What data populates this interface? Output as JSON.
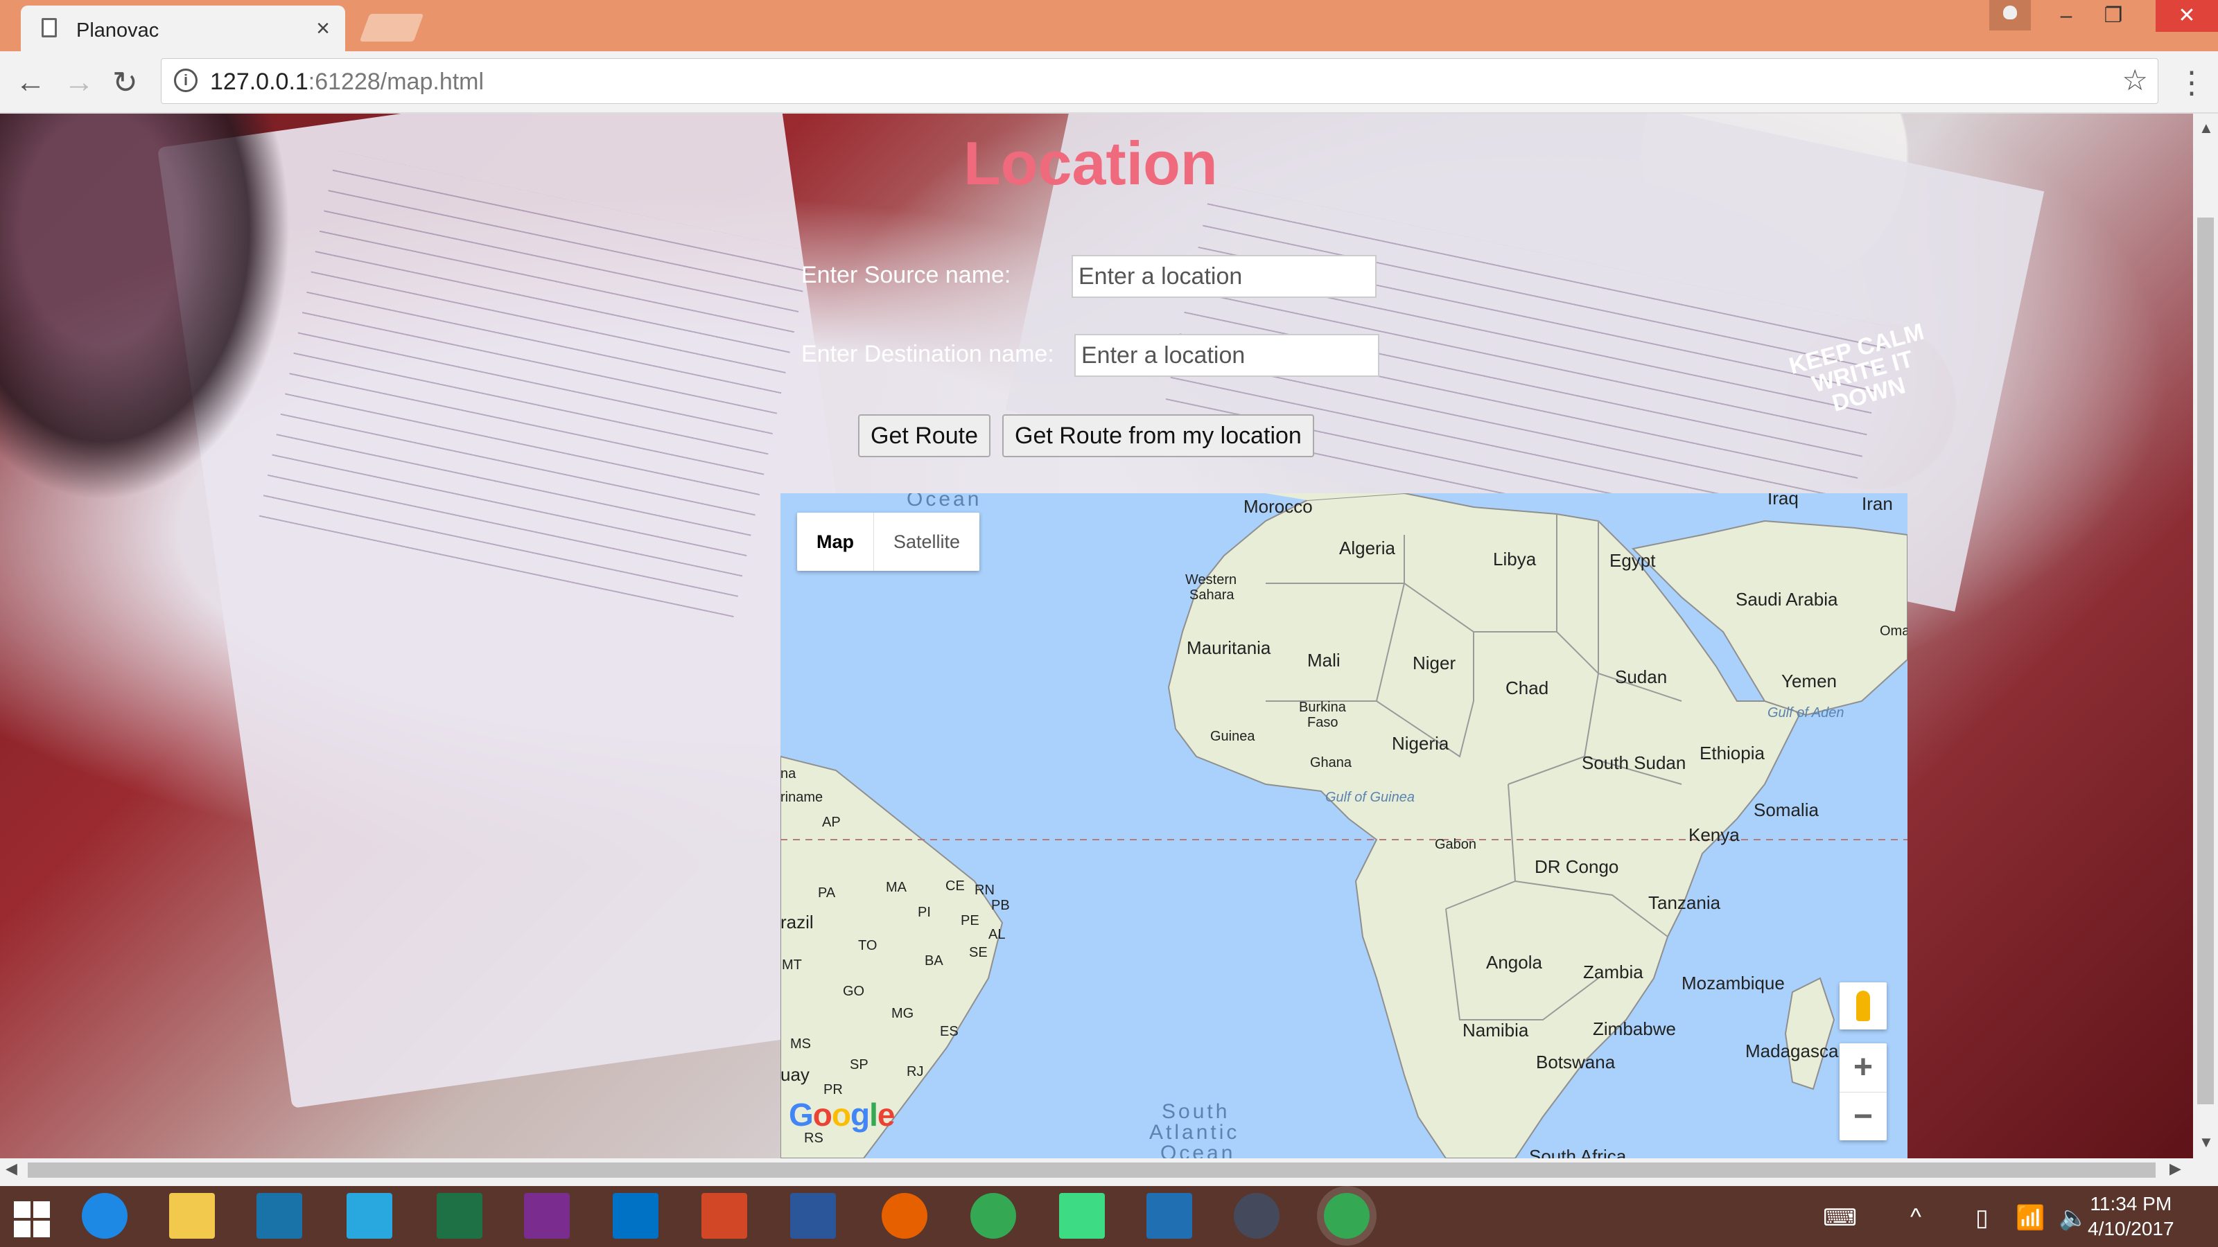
{
  "browser": {
    "tab_title": "Planovac",
    "tab_close": "×",
    "url_host": "127.0.0.1",
    "url_rest": ":61228/map.html",
    "back_icon": "←",
    "forward_icon": "→",
    "reload_icon": "↻",
    "star_icon": "☆",
    "menu_icon": "⋮",
    "minimize": "–",
    "restore": "❐",
    "close": "✕"
  },
  "page": {
    "title": "Location",
    "source_label": "Enter Source name:",
    "source_placeholder": "Enter a location",
    "dest_label": "Enter Destination name:",
    "dest_placeholder": "Enter a location",
    "get_route": "Get Route",
    "get_route_my_location": "Get Route from my location"
  },
  "map": {
    "type_map": "Map",
    "type_satellite": "Satellite",
    "zoom_in": "+",
    "zoom_out": "−",
    "logo": "Google",
    "labels": {
      "morocco": "Morocco",
      "algeria": "Algeria",
      "libya": "Libya",
      "egypt": "Egypt",
      "iraq": "Iraq",
      "iran": "Iran",
      "western_sahara_1": "Western",
      "western_sahara_2": "Sahara",
      "saudi_arabia": "Saudi Arabia",
      "oman": "Oma",
      "mauritania": "Mauritania",
      "mali": "Mali",
      "niger": "Niger",
      "chad": "Chad",
      "sudan": "Sudan",
      "yemen": "Yemen",
      "gulf_of_aden": "Gulf of Aden",
      "burkina_1": "Burkina",
      "burkina_2": "Faso",
      "guinea": "Guinea",
      "nigeria": "Nigeria",
      "ghana": "Ghana",
      "south_sudan": "South Sudan",
      "ethiopia": "Ethiopia",
      "gulf_of_guinea": "Gulf of Guinea",
      "somalia": "Somalia",
      "gabon": "Gabon",
      "dr_congo": "DR Congo",
      "kenya": "Kenya",
      "tanzania": "Tanzania",
      "angola": "Angola",
      "zambia": "Zambia",
      "mozambique": "Mozambique",
      "namibia": "Namibia",
      "zimbabwe": "Zimbabwe",
      "botswana": "Botswana",
      "madagascar": "Madagasca",
      "ocean_top": "Ocean",
      "south_atlantic_1": "South",
      "south_atlantic_2": "Atlantic",
      "south_atlantic_3": "Ocean",
      "south_africa": "South Africa",
      "suriname": "riname",
      "na": "na",
      "ap": "AP",
      "pa": "PA",
      "ma": "MA",
      "ce": "CE",
      "rn": "RN",
      "pb": "PB",
      "pi": "PI",
      "pe": "PE",
      "al": "AL",
      "brazil": "razil",
      "to": "TO",
      "ba": "BA",
      "se": "SE",
      "mt": "MT",
      "go": "GO",
      "mg": "MG",
      "es": "ES",
      "ms": "MS",
      "sp": "SP",
      "rj": "RJ",
      "uay": "uay",
      "pr": "PR",
      "rs": "RS"
    }
  },
  "background": {
    "keep_calm": "KEEP CALM WRITE IT DOWN"
  },
  "taskbar": {
    "time": "11:34 PM",
    "date": "4/10/2017"
  },
  "colors": {
    "title": "#f06a7d",
    "titlebar": "#e9946a",
    "water": "#a9d1fb",
    "land": "#e8edd7",
    "taskbar": "#59352b"
  }
}
